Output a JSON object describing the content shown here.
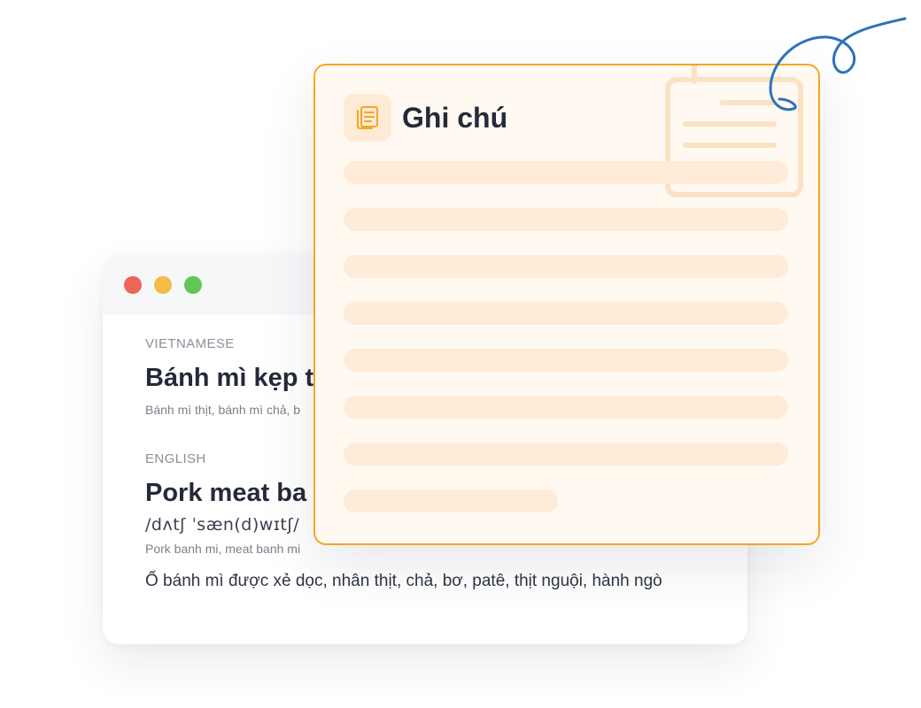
{
  "window_controls": {
    "colors": [
      "#ee6456",
      "#f4bb45",
      "#60c654"
    ]
  },
  "dictionary": {
    "vietnamese": {
      "label": "VIETNAMESE",
      "word": "Bánh mì kẹp t",
      "synonyms": "Bánh mì thịt, bánh mì chả, b"
    },
    "english": {
      "label": "ENGLISH",
      "word": "Pork meat ba",
      "phonetic": "/dʌtʃ ˈsæn(d)wɪtʃ/",
      "synonyms": "Pork banh mi, meat banh mi"
    },
    "definition": "Ổ bánh mì được xẻ dọc, nhân thịt, chả, bơ, patê, thịt nguội, hành ngò"
  },
  "note": {
    "title": "Ghi chú",
    "icon": "notes-icon",
    "accent_color": "#f5a623",
    "placeholder_line_count": 8
  },
  "decoration": {
    "squiggle_color": "#2b73b9"
  }
}
